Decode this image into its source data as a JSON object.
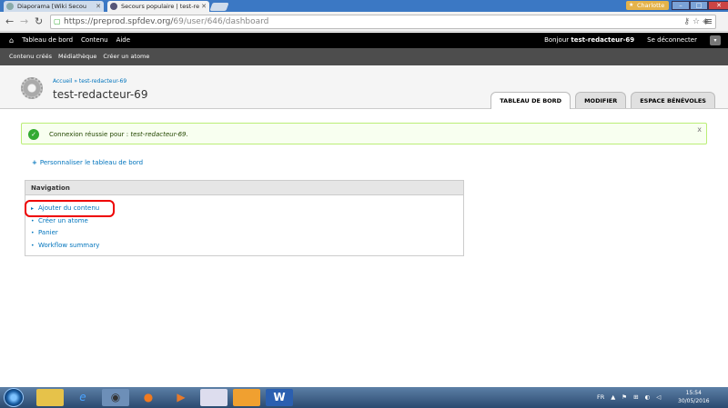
{
  "browser": {
    "tabs": [
      {
        "label": "Diaporama [Wiki Secou",
        "active": false
      },
      {
        "label": "Secours populaire | test-re",
        "active": true
      }
    ],
    "user_badge": "Charlotte",
    "url_host": "https://preprod.spfdev.org/",
    "url_path": "69/user/646/dashboard"
  },
  "admin_bar": {
    "items": [
      "Tableau de bord",
      "Contenu",
      "Aide"
    ],
    "greeting": "Bonjour",
    "username": "test-redacteur-69",
    "logout": "Se déconnecter"
  },
  "shortcuts": [
    "Contenu créés",
    "Médiathèque",
    "Créer un atome"
  ],
  "header": {
    "breadcrumb": "Accueil » test-redacteur-69",
    "title": "test-redacteur-69",
    "tabs": [
      {
        "label": "TABLEAU DE BORD",
        "active": true
      },
      {
        "label": "MODIFIER",
        "active": false
      },
      {
        "label": "ESPACE BÉNÉVOLES",
        "active": false
      }
    ]
  },
  "message": {
    "prefix": "Connexion réussie pour :",
    "user": "test-redacteur-69.",
    "close": "x"
  },
  "customize": "Personnaliser le tableau de bord",
  "navigation": {
    "title": "Navigation",
    "items": [
      "Ajouter du contenu",
      "Créer un atome",
      "Panier",
      "Workflow summary"
    ]
  },
  "taskbar": {
    "lang": "FR",
    "time": "15:54",
    "date": "30/05/2016"
  }
}
